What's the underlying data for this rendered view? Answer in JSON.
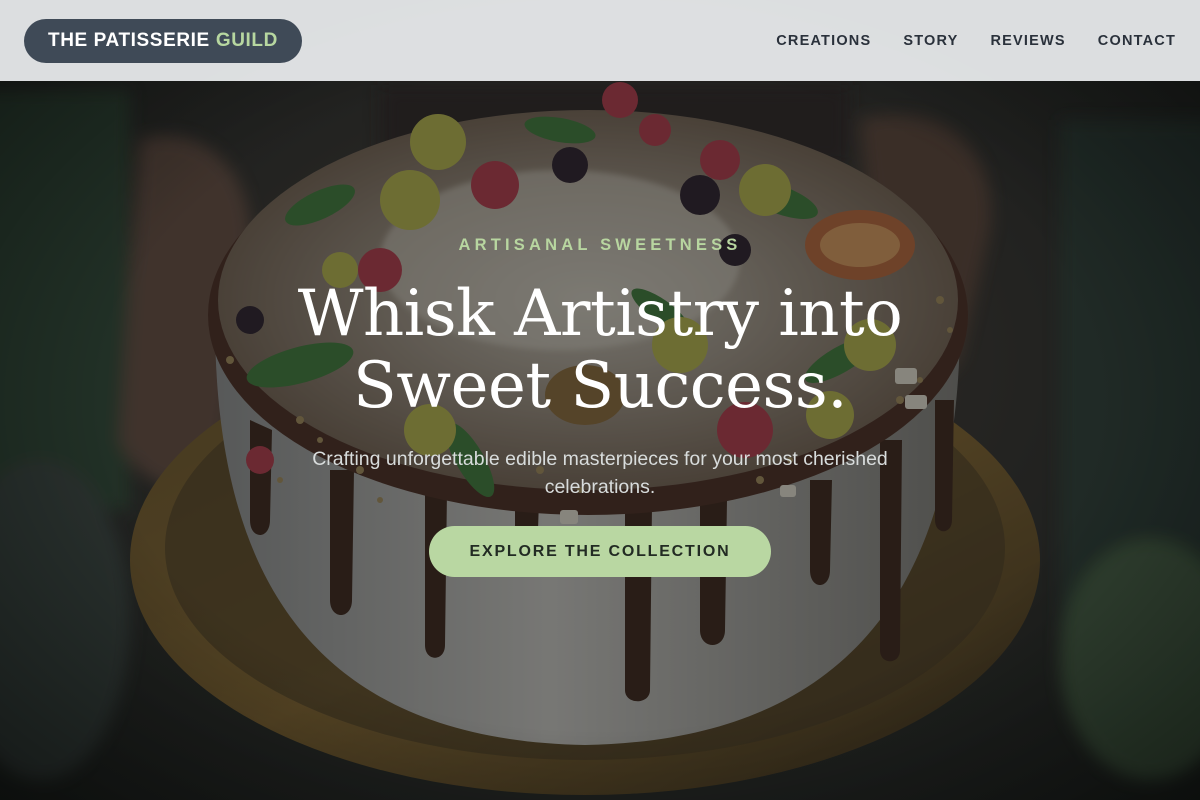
{
  "header": {
    "brand": {
      "main": "THE PATISSERIE",
      "accent": "GUILD"
    },
    "nav": [
      {
        "label": "CREATIONS"
      },
      {
        "label": "STORY"
      },
      {
        "label": "REVIEWS"
      },
      {
        "label": "CONTACT"
      }
    ]
  },
  "hero": {
    "eyebrow": "ARTISANAL SWEETNESS",
    "headline_lines": [
      "Whisk Artistry into",
      "Sweet Success."
    ],
    "subheadline": "Crafting unforgettable edible masterpieces for your most cherished celebrations.",
    "cta_label": "EXPLORE THE COLLECTION"
  },
  "colors": {
    "header_bg": "#eceef0",
    "brand_pill": "#3f4a57",
    "accent_green": "#b9d7a2",
    "nav_text": "#2a313b",
    "overlay_dark": "#1d1f1f"
  },
  "images": {
    "hero_background": "photo of hands holding a white cake with chocolate drip topped with berries, grapes, mint and nuts"
  }
}
